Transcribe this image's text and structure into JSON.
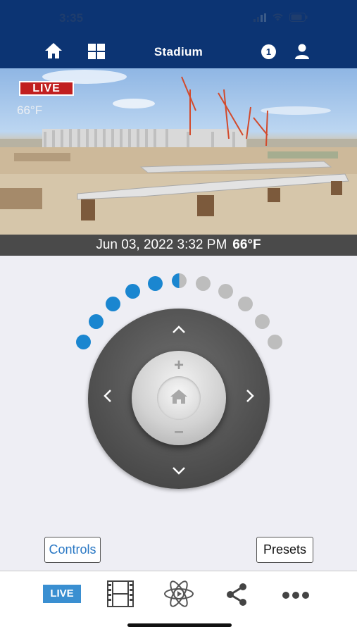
{
  "status_bar": {
    "time": "3:35"
  },
  "nav": {
    "title": "Stadium",
    "notification_count": "1",
    "icons": [
      "home-icon",
      "grid-icon",
      "notification-badge",
      "user-icon"
    ]
  },
  "camera": {
    "live_label": "LIVE",
    "overlay_temp": "66°F",
    "timestamp": "Jun 03, 2022 3:32 PM",
    "timestamp_temp": "66°F"
  },
  "zoom_indicator": {
    "total_dots": 11,
    "active_dots": 5.5,
    "active_color": "#1a86d0",
    "inactive_color": "#bdbdbd"
  },
  "joystick": {
    "zoom_in_symbol": "+",
    "zoom_out_symbol": "–"
  },
  "buttons": {
    "controls": "Controls",
    "presets": "Presets"
  },
  "tab_bar": {
    "live_label": "LIVE",
    "items": [
      "live-tab",
      "film-icon",
      "atom-icon",
      "share-icon",
      "more-icon"
    ]
  },
  "colors": {
    "header": "#0c3473",
    "live_red": "#c11f1f",
    "accent_blue": "#3a8fd1"
  }
}
